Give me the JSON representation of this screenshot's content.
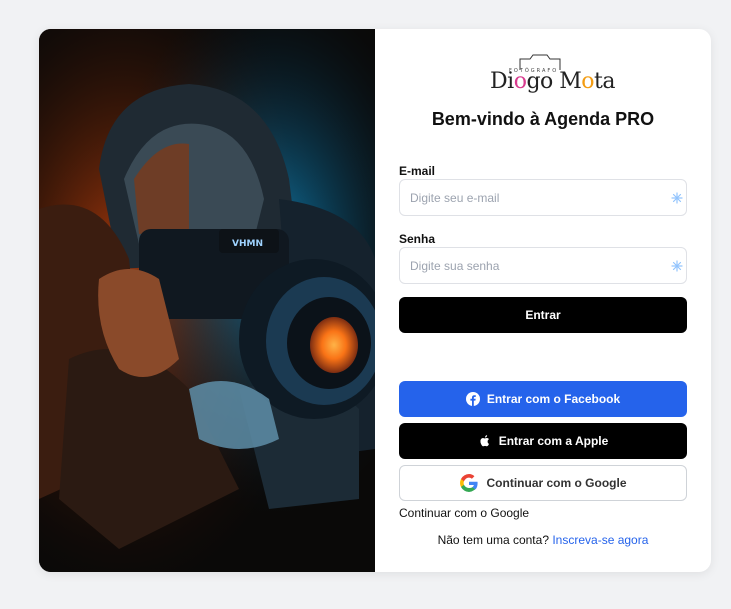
{
  "brand": {
    "logo_small_text": "FOTÓGRAFO",
    "logo_name_part1": "Di",
    "logo_name_o1": "o",
    "logo_name_part2": "go M",
    "logo_name_o2": "o",
    "logo_name_part3": "ta"
  },
  "form": {
    "title": "Bem-vindo à Agenda PRO",
    "email_label": "E-mail",
    "email_placeholder": "Digite seu e-mail",
    "email_value": "",
    "password_label": "Senha",
    "password_placeholder": "Digite sua senha",
    "password_value": "",
    "submit_label": "Entrar"
  },
  "social": {
    "facebook_label": "Entrar com o Facebook",
    "apple_label": "Entrar com a Apple",
    "google_label": "Continuar com o Google",
    "google_text_link": "Continuar com o Google"
  },
  "signup": {
    "prompt": "Não tem uma conta?",
    "link": "Inscreva-se agora"
  },
  "icons": {
    "email_field_icon": "sparkle-icon",
    "password_field_icon": "sparkle-icon",
    "facebook_icon": "facebook-icon",
    "apple_icon": "apple-icon",
    "google_icon": "google-icon"
  },
  "colors": {
    "background": "#f1f2f4",
    "primary_button": "#000000",
    "facebook_button": "#2563eb",
    "link": "#2563eb"
  }
}
